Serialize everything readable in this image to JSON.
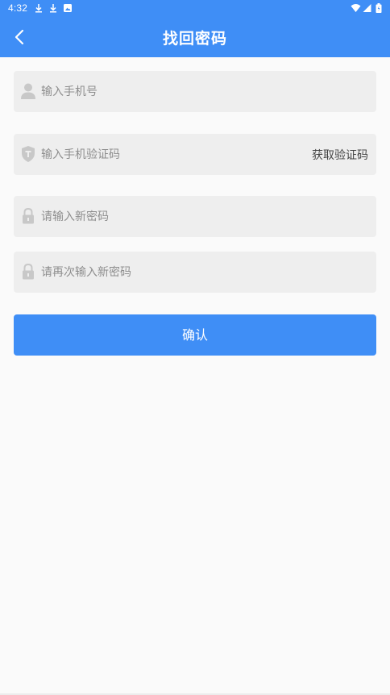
{
  "status_bar": {
    "time": "4:32",
    "icons": [
      "download-icon",
      "download-icon",
      "photo-icon",
      "wifi-icon",
      "signal-icon",
      "battery-icon"
    ]
  },
  "header": {
    "title": "找回密码",
    "back_icon": "chevron-left-icon"
  },
  "form": {
    "phone": {
      "placeholder": "输入手机号",
      "icon": "user-icon"
    },
    "code": {
      "placeholder": "输入手机验证码",
      "icon": "shield-icon",
      "get_code_label": "获取验证码"
    },
    "new_password": {
      "placeholder": "请输入新密码",
      "icon": "lock-icon"
    },
    "confirm_password": {
      "placeholder": "请再次输入新密码",
      "icon": "lock-icon"
    },
    "submit_label": "确认"
  },
  "colors": {
    "primary": "#3f8ef6",
    "field_bg": "#eeeeee",
    "page_bg": "#fafafa",
    "icon_gray": "#c8c8c8"
  }
}
